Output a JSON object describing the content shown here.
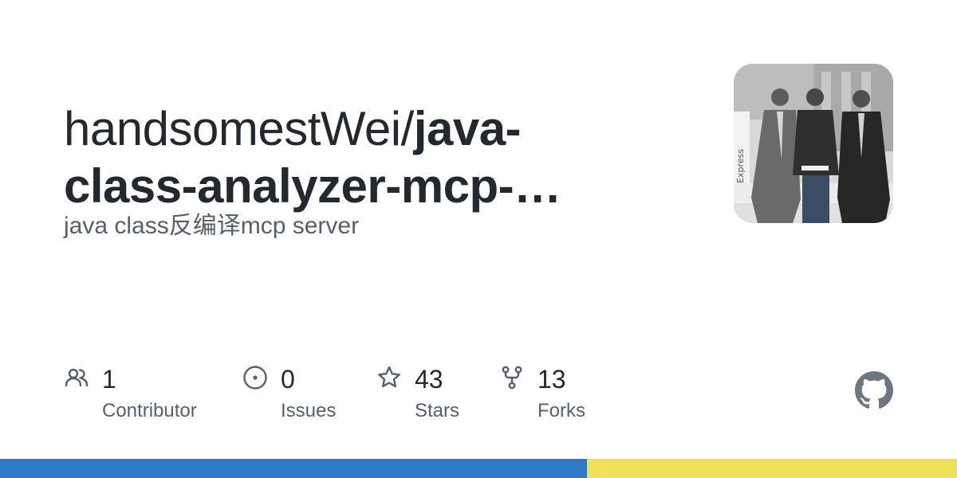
{
  "repo": {
    "owner": "handsomestWei/",
    "name_line1": "java-",
    "name_line2": "class-analyzer-mcp-…",
    "description": "java class反编译mcp server"
  },
  "stats": [
    {
      "value": "1",
      "label": "Contributor",
      "icon": "people-icon"
    },
    {
      "value": "0",
      "label": "Issues",
      "icon": "issue-opened-icon"
    },
    {
      "value": "43",
      "label": "Stars",
      "icon": "star-icon"
    },
    {
      "value": "13",
      "label": "Forks",
      "icon": "repo-forked-icon"
    }
  ],
  "languages": [
    {
      "color": "#3178c6",
      "share": 0.613
    },
    {
      "color": "#f1e05a",
      "share": 0.387
    }
  ],
  "colors": {
    "text": "#24292f",
    "muted": "#57606a",
    "icon": "#57606a",
    "logo": "#6e7681"
  }
}
